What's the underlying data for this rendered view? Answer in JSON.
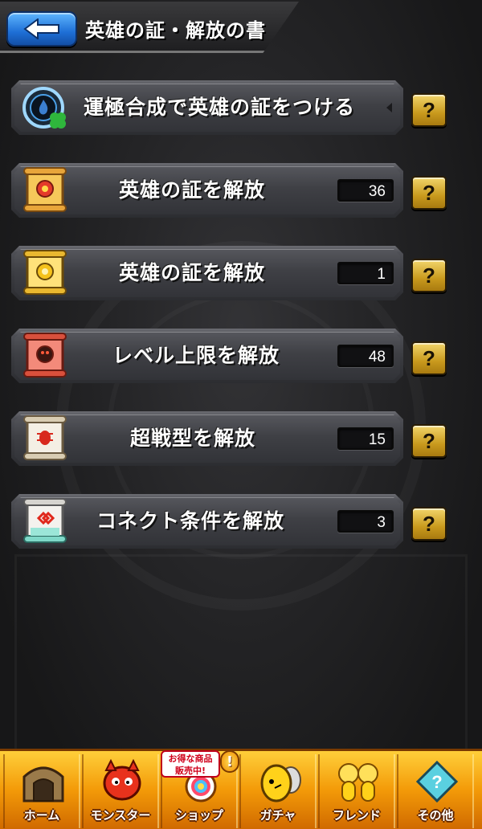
{
  "header": {
    "title": "英雄の証・解放の書",
    "back_icon": "arrow-left-icon"
  },
  "colors": {
    "help_button": "#c99a1d",
    "back_button": "#1e6fd6",
    "nav_bar": "#f39a08"
  },
  "menu": [
    {
      "label": "運極合成で英雄の証をつける",
      "count": null,
      "icon": "luck-clover-medal-icon",
      "help": "?"
    },
    {
      "label": "英雄の証を解放",
      "count": "36",
      "icon": "red-scroll-icon",
      "help": "?"
    },
    {
      "label": "英雄の証を解放",
      "count": "1",
      "icon": "gold-scroll-icon",
      "help": "?"
    },
    {
      "label": "レベル上限を解放",
      "count": "48",
      "icon": "red-monster-scroll-icon",
      "help": "?"
    },
    {
      "label": "超戦型を解放",
      "count": "15",
      "icon": "white-beetle-scroll-icon",
      "help": "?"
    },
    {
      "label": "コネクト条件を解放",
      "count": "3",
      "icon": "connect-scroll-icon",
      "help": "?"
    }
  ],
  "bottom_nav": {
    "sale_badge_line1": "お得な商品",
    "sale_badge_line2": "販売中!",
    "alert": "!",
    "tabs": [
      {
        "label": "ホーム",
        "icon": "home-gate-icon"
      },
      {
        "label": "モンスター",
        "icon": "red-dragon-icon"
      },
      {
        "label": "ショップ",
        "icon": "rainbow-orb-icon"
      },
      {
        "label": "ガチャ",
        "icon": "egg-icon"
      },
      {
        "label": "フレンド",
        "icon": "friends-icon"
      },
      {
        "label": "その他",
        "icon": "other-icon"
      }
    ]
  }
}
